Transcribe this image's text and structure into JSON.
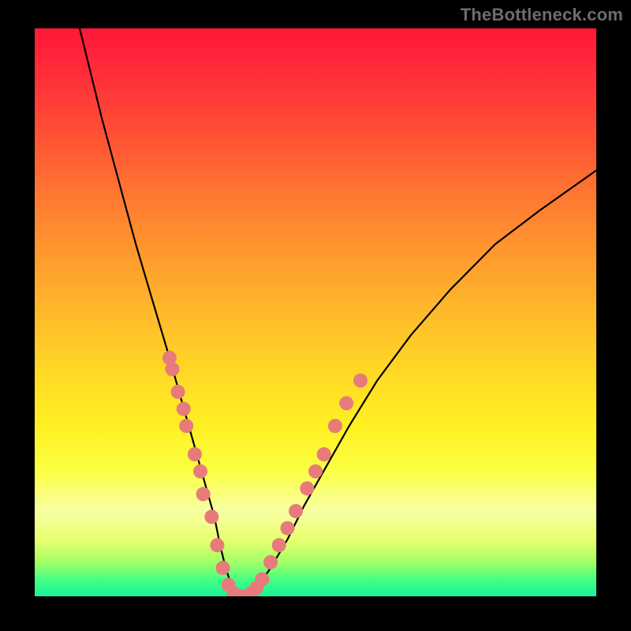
{
  "watermark": "TheBottleneck.com",
  "chart_data": {
    "type": "line",
    "title": "",
    "xlabel": "",
    "ylabel": "",
    "xlim": [
      0,
      100
    ],
    "ylim": [
      0,
      100
    ],
    "grid": false,
    "legend": false,
    "series": [
      {
        "name": "bottleneck-curve",
        "x": [
          8,
          10,
          12,
          15,
          18,
          21,
          24,
          26,
          28,
          30,
          32,
          33,
          34,
          35,
          36.5,
          38,
          40,
          42,
          45,
          48,
          52,
          56,
          61,
          67,
          74,
          82,
          90,
          100
        ],
        "values": [
          100,
          92,
          84,
          73,
          62,
          52,
          42,
          35,
          28,
          21,
          14,
          9,
          5,
          2,
          0,
          0,
          2,
          5,
          10,
          16,
          23,
          30,
          38,
          46,
          54,
          62,
          68,
          75
        ]
      }
    ],
    "markers": [
      {
        "x": 24.0,
        "y": 42
      },
      {
        "x": 24.5,
        "y": 40
      },
      {
        "x": 25.5,
        "y": 36
      },
      {
        "x": 26.5,
        "y": 33
      },
      {
        "x": 27.0,
        "y": 30
      },
      {
        "x": 28.5,
        "y": 25
      },
      {
        "x": 29.5,
        "y": 22
      },
      {
        "x": 30.0,
        "y": 18
      },
      {
        "x": 31.5,
        "y": 14
      },
      {
        "x": 32.5,
        "y": 9
      },
      {
        "x": 33.5,
        "y": 5
      },
      {
        "x": 34.5,
        "y": 2
      },
      {
        "x": 35.5,
        "y": 0.5
      },
      {
        "x": 36.5,
        "y": 0
      },
      {
        "x": 37.5,
        "y": 0
      },
      {
        "x": 38.5,
        "y": 0.5
      },
      {
        "x": 39.5,
        "y": 1.5
      },
      {
        "x": 40.5,
        "y": 3
      },
      {
        "x": 42.0,
        "y": 6
      },
      {
        "x": 43.5,
        "y": 9
      },
      {
        "x": 45.0,
        "y": 12
      },
      {
        "x": 46.5,
        "y": 15
      },
      {
        "x": 48.5,
        "y": 19
      },
      {
        "x": 50.0,
        "y": 22
      },
      {
        "x": 51.5,
        "y": 25
      },
      {
        "x": 53.5,
        "y": 30
      },
      {
        "x": 55.5,
        "y": 34
      },
      {
        "x": 58.0,
        "y": 38
      }
    ],
    "gradient_stops": [
      {
        "pos": 0,
        "color": "#ff1837"
      },
      {
        "pos": 50,
        "color": "#ffd726"
      },
      {
        "pos": 85,
        "color": "#f8ffa4"
      },
      {
        "pos": 100,
        "color": "#17f39a"
      }
    ],
    "marker_color": "#e77b7b",
    "line_color": "#000000"
  }
}
